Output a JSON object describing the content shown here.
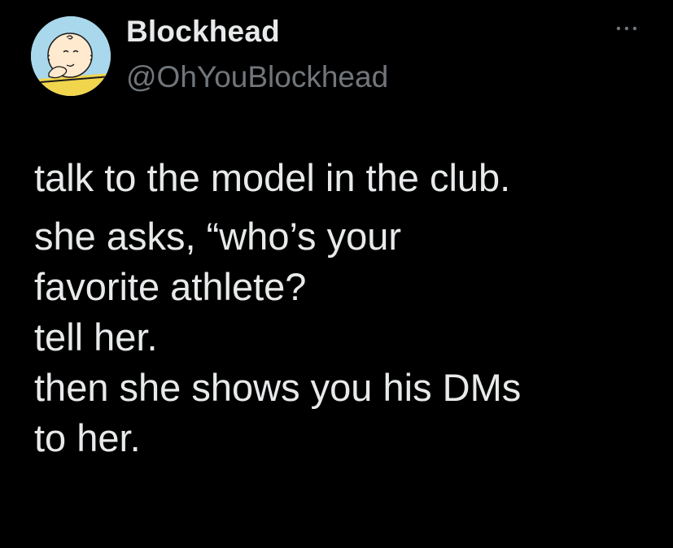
{
  "author": {
    "display_name": "Blockhead",
    "handle": "@OhYouBlockhead",
    "avatar_icon": "charlie-brown-avatar"
  },
  "more_menu_icon": "more-dots-icon",
  "tweet": {
    "paragraphs": [
      {
        "lines": [
          "talk to the model in the club."
        ]
      },
      {
        "lines": [
          "she asks, “who’s your",
          "favorite athlete?",
          "tell her.",
          "then she shows you his DMs",
          "to her."
        ]
      }
    ]
  },
  "colors": {
    "background": "#000000",
    "primary_text": "#e7e9ea",
    "secondary_text": "#71767b",
    "avatar_bg": "#a9d8ec"
  }
}
